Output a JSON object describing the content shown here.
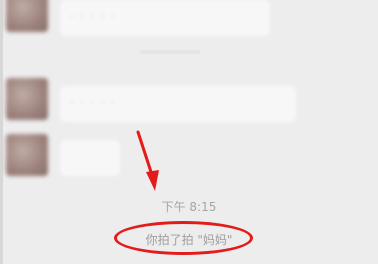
{
  "chat": {
    "timestamp": "下午 8:15",
    "pat_notice": "你拍了拍 \"妈妈\"",
    "blurred_text_1": "·····",
    "blurred_text_2": "·····"
  },
  "colors": {
    "background": "#ededed",
    "annotation_red": "#e41b1b",
    "system_text": "#a5a5a5"
  },
  "icons": {
    "annotation_arrow": "red-arrow-pointing-down",
    "annotation_circle": "red-ellipse-highlight"
  }
}
